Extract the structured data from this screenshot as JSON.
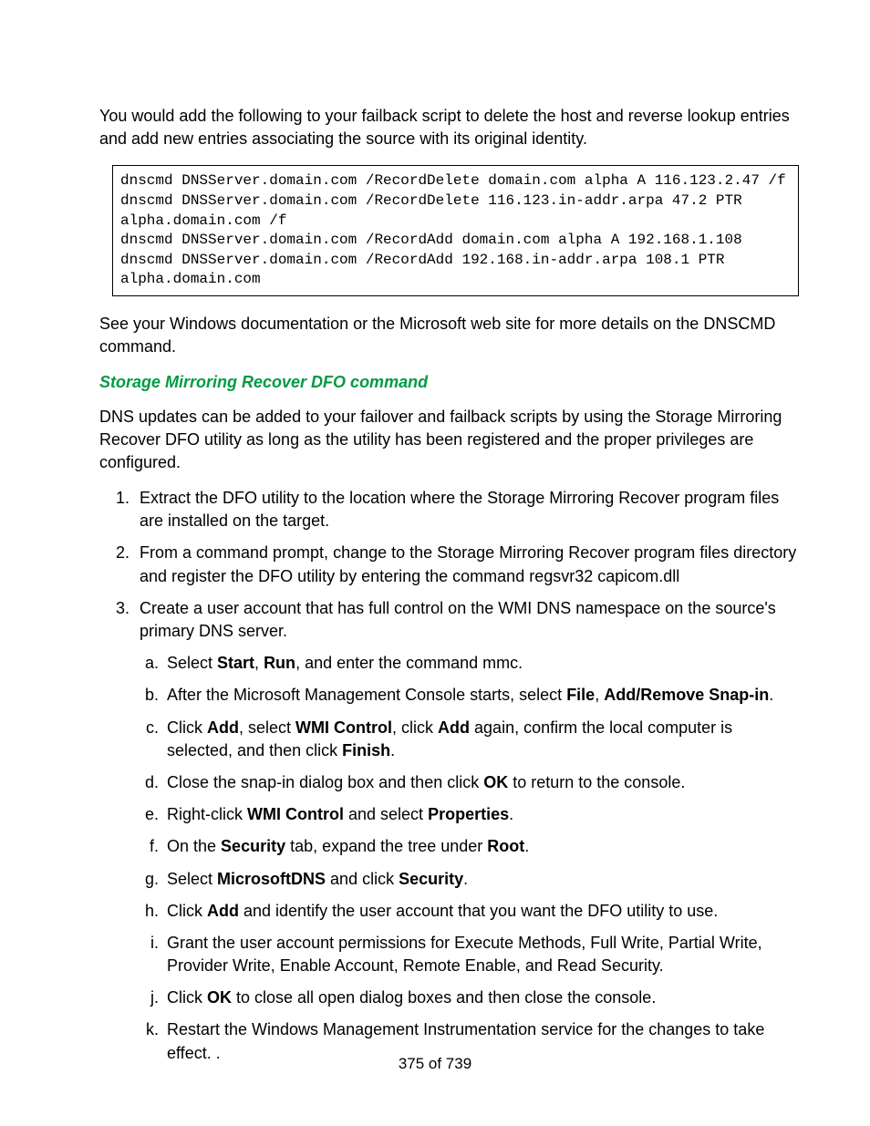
{
  "intro_p1": "You would add the following to your failback script to delete the host and reverse lookup entries and add new entries associating the source with its original identity.",
  "code_block": "dnscmd DNSServer.domain.com /RecordDelete domain.com alpha A 116.123.2.47 /f\ndnscmd DNSServer.domain.com /RecordDelete 116.123.in-addr.arpa 47.2 PTR\nalpha.domain.com /f\ndnscmd DNSServer.domain.com /RecordAdd domain.com alpha A 192.168.1.108\ndnscmd DNSServer.domain.com /RecordAdd 192.168.in-addr.arpa 108.1 PTR\nalpha.domain.com",
  "post_code_p": "See your Windows documentation or the Microsoft web site for more details on the DNSCMD command.",
  "heading": "Storage Mirroring Recover DFO command",
  "dfo_intro": "DNS updates can be added to your failover and failback scripts by using the Storage Mirroring Recover DFO utility as long as the utility has been registered and the proper privileges are configured.",
  "steps": {
    "s1": "Extract the DFO utility to the location where the Storage Mirroring Recover program files are installed on the target.",
    "s2": "From a command prompt, change to the Storage Mirroring Recover program files directory and register the DFO utility by entering the command regsvr32 capicom.dll",
    "s3": "Create a user account that has full control on the WMI DNS namespace on the source's primary DNS server.",
    "sub": {
      "a_pre": "Select ",
      "a_b1": "Start",
      "a_mid1": ", ",
      "a_b2": "Run",
      "a_post": ", and enter the command mmc.",
      "b_pre": "After the Microsoft Management Console starts, select ",
      "b_b1": "File",
      "b_mid1": ", ",
      "b_b2": "Add/Remove Snap-in",
      "b_post": ".",
      "c_pre": "Click ",
      "c_b1": "Add",
      "c_mid1": ", select ",
      "c_b2": "WMI Control",
      "c_mid2": ", click ",
      "c_b3": "Add",
      "c_mid3": " again, confirm the local computer is selected, and then click ",
      "c_b4": "Finish",
      "c_post": ".",
      "d_pre": "Close the snap-in dialog box and then click ",
      "d_b1": "OK",
      "d_post": " to return to the console.",
      "e_pre": "Right-click ",
      "e_b1": "WMI Control",
      "e_mid1": " and select ",
      "e_b2": "Properties",
      "e_post": ".",
      "f_pre": "On the ",
      "f_b1": "Security",
      "f_mid1": " tab, expand the tree under ",
      "f_b2": "Root",
      "f_post": ".",
      "g_pre": "Select ",
      "g_b1": "MicrosoftDNS",
      "g_mid1": " and click ",
      "g_b2": "Security",
      "g_post": ".",
      "h_pre": "Click ",
      "h_b1": "Add",
      "h_post": " and identify the user account that you want the DFO utility to use.",
      "i": "Grant the user account permissions for Execute Methods, Full Write, Partial Write, Provider Write, Enable Account, Remote Enable, and Read Security.",
      "j_pre": "Click ",
      "j_b1": "OK",
      "j_post": " to close all open dialog boxes and then close the console.",
      "k": "Restart the Windows Management Instrumentation service for the changes to take effect. ."
    }
  },
  "footer": "375 of 739"
}
